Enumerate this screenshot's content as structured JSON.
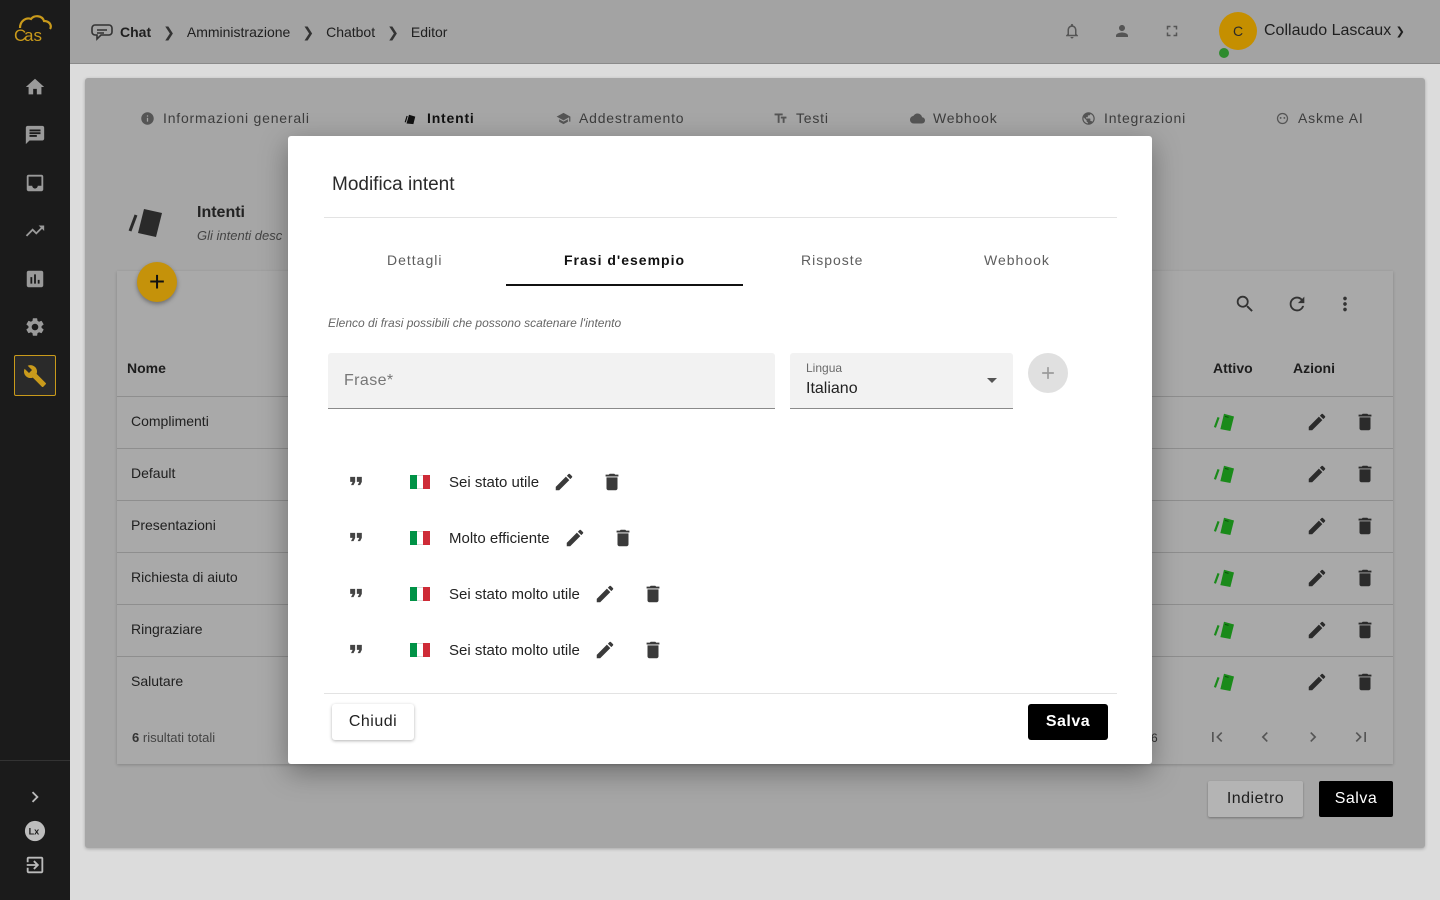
{
  "sidebar": {
    "logo_text": "as",
    "items": [
      {
        "icon": "home-icon"
      },
      {
        "icon": "chat-icon"
      },
      {
        "icon": "inbox-icon"
      },
      {
        "icon": "trending-icon"
      },
      {
        "icon": "bar-chart-icon"
      },
      {
        "icon": "gear-icon"
      },
      {
        "icon": "wrench-icon",
        "active": true
      }
    ],
    "bottom": [
      {
        "icon": "chevron-right-icon"
      },
      {
        "icon": "lx-logo-icon"
      },
      {
        "icon": "logout-icon"
      }
    ]
  },
  "topbar": {
    "breadcrumb": [
      "Chat",
      "Amministrazione",
      "Chatbot",
      "Editor"
    ],
    "avatar_initial": "C",
    "username": "Collaudo Lascaux"
  },
  "main_tabs": [
    {
      "label": "Informazioni generali",
      "icon": "info-icon"
    },
    {
      "label": "Intenti",
      "icon": "intent-icon",
      "active": true
    },
    {
      "label": "Addestramento",
      "icon": "school-icon"
    },
    {
      "label": "Testi",
      "icon": "text-icon"
    },
    {
      "label": "Webhook",
      "icon": "cloud-icon"
    },
    {
      "label": "Integrazioni",
      "icon": "globe-icon"
    },
    {
      "label": "Askme AI",
      "icon": "ai-icon"
    }
  ],
  "intenti": {
    "title": "Intenti",
    "subtitle": "Gli intenti desc",
    "columns": {
      "name": "Nome",
      "active": "Attivo",
      "actions": "Azioni"
    },
    "rows": [
      "Complimenti",
      "Default",
      "Presentazioni",
      "Richiesta di aiuto",
      "Ringraziare",
      "Salutare"
    ],
    "results_count": "6",
    "results_label": "risultati totali",
    "page_count_fragment": "6",
    "back_label": "Indietro",
    "save_label": "Salva"
  },
  "modal": {
    "title": "Modifica intent",
    "tabs": [
      "Dettagli",
      "Frasi d'esempio",
      "Risposte",
      "Webhook"
    ],
    "active_tab": 1,
    "hint": "Elenco di frasi possibili che possono scatenare l'intento",
    "frase_placeholder": "Frase*",
    "lingua_label": "Lingua",
    "lingua_value": "Italiano",
    "phrases": [
      {
        "text": "Sei stato utile",
        "lang": "it"
      },
      {
        "text": "Molto efficiente",
        "lang": "it"
      },
      {
        "text": "Sei stato molto utile",
        "lang": "it"
      },
      {
        "text": "Sei stato molto utile",
        "lang": "it"
      }
    ],
    "close_label": "Chiudi",
    "save_label": "Salva"
  },
  "colors": {
    "accent": "#c5920a",
    "flag_green": "#009246",
    "flag_white": "#ffffff",
    "flag_red": "#ce2b37",
    "intent_green": "#1a8a1a"
  }
}
